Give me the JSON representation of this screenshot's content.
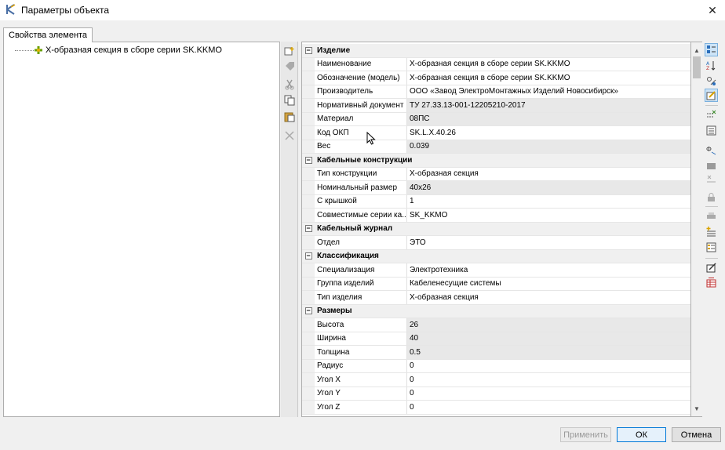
{
  "window": {
    "title": "Параметры объекта"
  },
  "tabs": [
    {
      "label": "Свойства элемента"
    }
  ],
  "tree": {
    "item_label": "Х-образная секция в сборе серии SK.KKMO"
  },
  "properties": [
    {
      "category": "Изделие",
      "items": [
        {
          "name": "Наименование",
          "value": "Х-образная секция в сборе серии SK.KKMO",
          "gray": false
        },
        {
          "name": "Обозначение (модель)",
          "value": "Х-образная секция в сборе серии SK.KKMO",
          "gray": false
        },
        {
          "name": "Производитель",
          "value": "ООО «Завод ЭлектроМонтажных Изделий Новосибирск»",
          "gray": false
        },
        {
          "name": "Нормативный документ",
          "value": "ТУ 27.33.13-001-12205210-2017",
          "gray": true
        },
        {
          "name": "Материал",
          "value": "08ПС",
          "gray": true
        },
        {
          "name": "Код ОКП",
          "value": "SK.L.X.40.26",
          "gray": false
        },
        {
          "name": "Вес",
          "value": "0.039",
          "gray": true
        }
      ]
    },
    {
      "category": "Кабельные конструкции",
      "items": [
        {
          "name": "Тип конструкции",
          "value": "Х-образная секция",
          "gray": false
        },
        {
          "name": "Номинальный размер",
          "value": "40х26",
          "gray": true
        },
        {
          "name": "С крышкой",
          "value": "1",
          "gray": false
        },
        {
          "name": "Совместимые серии ка...",
          "value": "SK_KKMO",
          "gray": false
        }
      ]
    },
    {
      "category": "Кабельный журнал",
      "items": [
        {
          "name": "Отдел",
          "value": "ЭТО",
          "gray": false
        }
      ]
    },
    {
      "category": "Классификация",
      "items": [
        {
          "name": "Специализация",
          "value": "Электротехника",
          "gray": false
        },
        {
          "name": "Группа изделий",
          "value": "Кабеленесущие системы",
          "gray": false
        },
        {
          "name": "Тип изделия",
          "value": "Х-образная секция",
          "gray": false
        }
      ]
    },
    {
      "category": "Размеры",
      "items": [
        {
          "name": "Высота",
          "value": "26",
          "gray": true
        },
        {
          "name": "Ширина",
          "value": "40",
          "gray": true
        },
        {
          "name": "Толщина",
          "value": "0.5",
          "gray": true
        },
        {
          "name": "Радиус",
          "value": "0",
          "gray": false
        },
        {
          "name": "Угол X",
          "value": "0",
          "gray": false
        },
        {
          "name": "Угол Y",
          "value": "0",
          "gray": false
        },
        {
          "name": "Угол Z",
          "value": "0",
          "gray": false
        }
      ]
    }
  ],
  "buttons": {
    "apply": "Применить",
    "ok": "ОК",
    "cancel": "Отмена"
  },
  "icons": {
    "mid_toolbar": [
      "add-element-icon",
      "tag-icon",
      "cut-icon",
      "copy-icon",
      "paste-icon",
      "delete-icon"
    ],
    "right_toolbar": [
      "categorized-view-icon",
      "sort-alphabetical-icon",
      "filter-properties-icon",
      "edit-properties-icon",
      "hide-properties-icon",
      "list-view-icon",
      "attribute-icon",
      "folder-icon",
      "remove-icon",
      "lock-icon",
      "printer-icon",
      "add-property-icon",
      "property-list-icon",
      "export-icon",
      "delete-table-icon"
    ]
  },
  "colors": {
    "accent": "#0078d7",
    "gray_cell": "#e8e8e8",
    "category_bg": "#f0f0f0"
  }
}
